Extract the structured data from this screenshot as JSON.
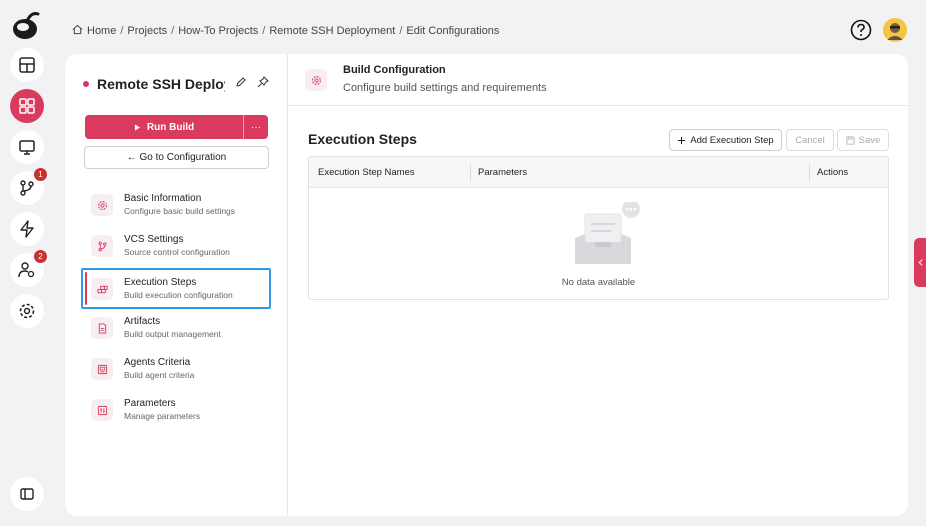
{
  "breadcrumb": [
    "Home",
    "Projects",
    "How-To Projects",
    "Remote SSH Deployment",
    "Edit Configurations"
  ],
  "rail": {
    "items": [
      {
        "icon": "dashboard-icon"
      },
      {
        "icon": "apps-grid-icon"
      },
      {
        "icon": "monitor-icon"
      },
      {
        "icon": "git-branch-icon",
        "badge": "1"
      },
      {
        "icon": "lightning-icon"
      },
      {
        "icon": "user-settings-icon",
        "badge": "2"
      },
      {
        "icon": "gear-icon"
      }
    ],
    "bottom_icon": "sidebar-toggle-icon"
  },
  "project": {
    "name": "Remote SSH Deployment",
    "run_label": "Run Build",
    "more_label": "···",
    "goto_label": "← Go to Configuration"
  },
  "nav": [
    {
      "title": "Basic Information",
      "subtitle": "Configure basic build settings",
      "icon": "gear-icon"
    },
    {
      "title": "VCS Settings",
      "subtitle": "Source control configuration",
      "icon": "git-branch-icon"
    },
    {
      "title": "Execution Steps",
      "subtitle": "Build execution configuration",
      "icon": "steps-icon",
      "selected": true
    },
    {
      "title": "Artifacts",
      "subtitle": "Build output management",
      "icon": "file-icon"
    },
    {
      "title": "Agents Criteria",
      "subtitle": "Build agent criteria",
      "icon": "agent-icon"
    },
    {
      "title": "Parameters",
      "subtitle": "Manage parameters",
      "icon": "parameters-icon"
    }
  ],
  "header": {
    "title": "Build Configuration",
    "subtitle": "Configure build settings and requirements"
  },
  "section": {
    "title": "Execution Steps",
    "add_label": "Add Execution Step",
    "cancel_label": "Cancel",
    "save_label": "Save"
  },
  "table": {
    "columns": [
      "Execution Step Names",
      "Parameters",
      "Actions"
    ],
    "empty_text": "No data available"
  },
  "colors": {
    "accent": "#d93a5e",
    "selection": "#2d9be6"
  }
}
